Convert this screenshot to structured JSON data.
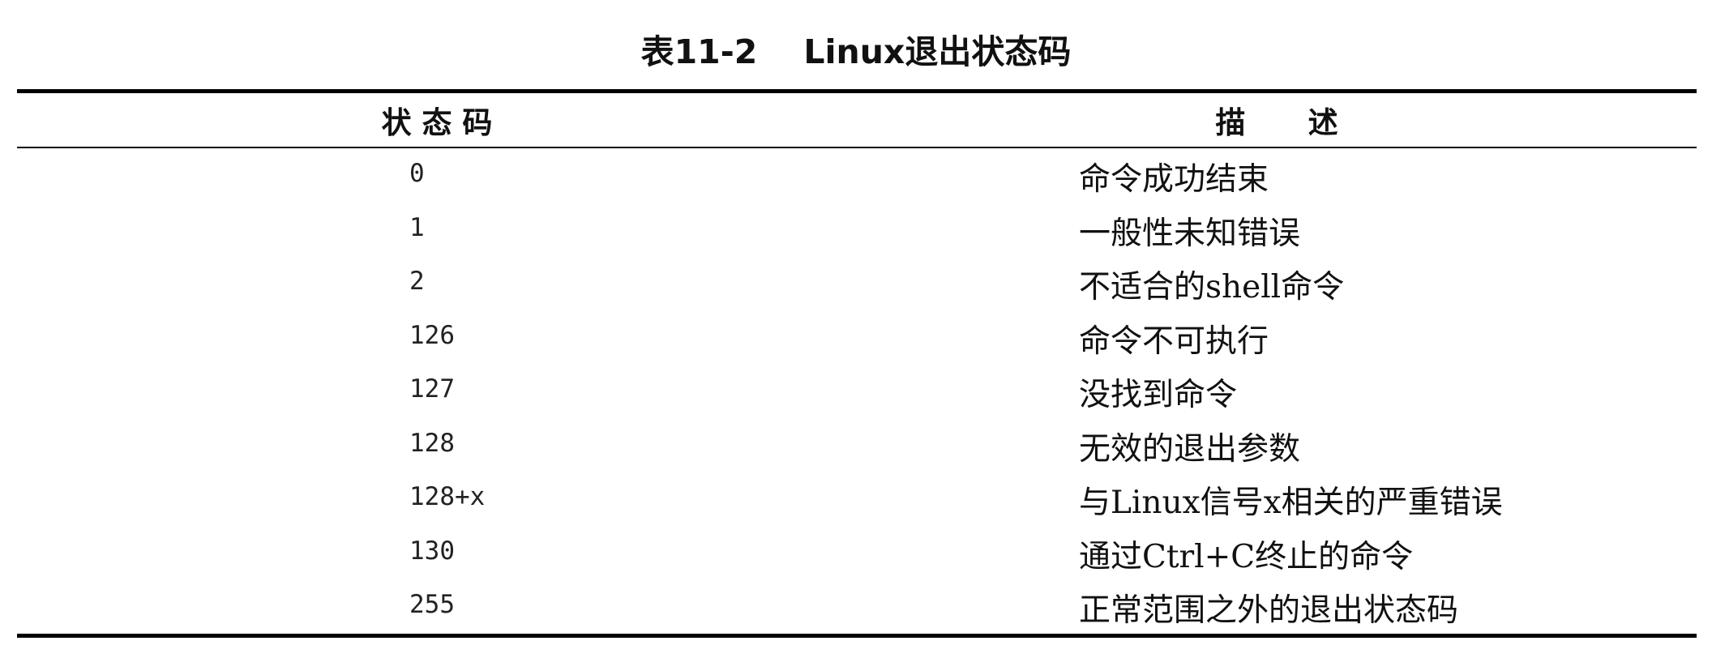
{
  "caption": "表11-2    Linux退出状态码",
  "table": {
    "headers": {
      "code": "状 态 码",
      "description": "描      述"
    },
    "rows": [
      {
        "code": "0",
        "description": "命令成功结束"
      },
      {
        "code": "1",
        "description": "一般性未知错误"
      },
      {
        "code": "2",
        "description": "不适合的shell命令"
      },
      {
        "code": "126",
        "description": "命令不可执行"
      },
      {
        "code": "127",
        "description": "没找到命令"
      },
      {
        "code": "128",
        "description": "无效的退出参数"
      },
      {
        "code": "128+x",
        "description": "与Linux信号x相关的严重错误"
      },
      {
        "code": "130",
        "description": "通过Ctrl+C终止的命令"
      },
      {
        "code": "255",
        "description": "正常范围之外的退出状态码"
      }
    ]
  }
}
